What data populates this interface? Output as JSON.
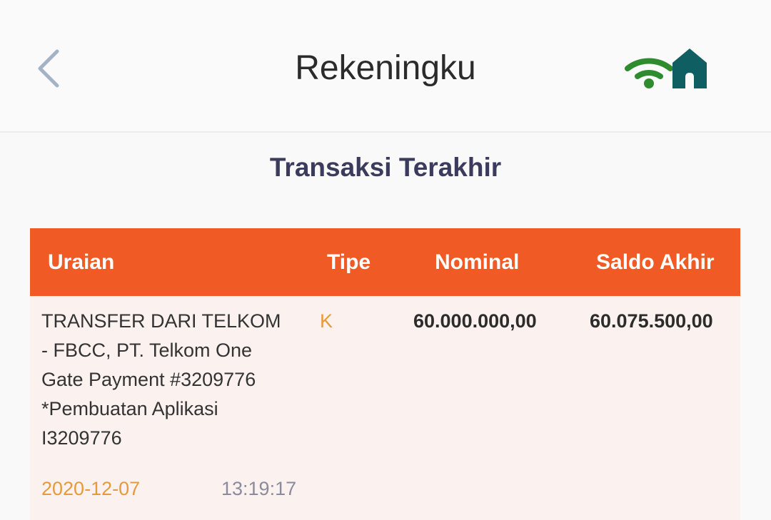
{
  "header": {
    "title": "Rekeningku",
    "back_icon": "chevron-left-icon",
    "wifi_icon": "wifi-icon",
    "home_icon": "home-icon",
    "colors": {
      "back": "#a3b3c5",
      "wifi": "#2e8b2e",
      "home": "#0f5f62"
    }
  },
  "section": {
    "title": "Transaksi Terakhir"
  },
  "table": {
    "header_color": "#f05a24",
    "columns": {
      "uraian": "Uraian",
      "tipe": "Tipe",
      "nominal": "Nominal",
      "saldo": "Saldo Akhir"
    },
    "rows": [
      {
        "description": "TRANSFER DARI TELKOM - FBCC, PT. Telkom One Gate Payment #3209776 *Pembuatan Aplikasi I3209776",
        "type": "K",
        "nominal": "60.000.000,00",
        "saldo": "60.075.500,00",
        "date": "2020-12-07",
        "time": "13:19:17"
      }
    ]
  }
}
